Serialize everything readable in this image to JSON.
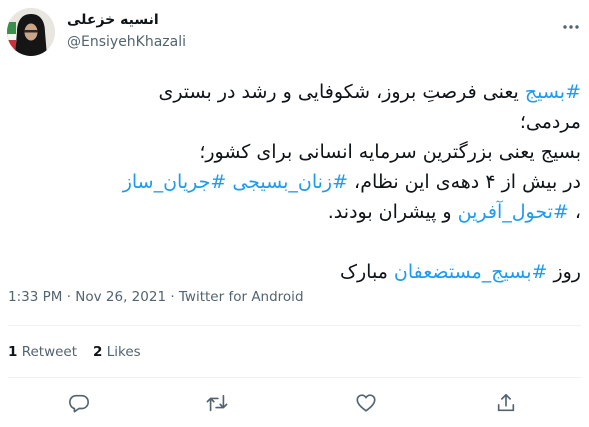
{
  "author": {
    "name": "انسیه خزعلی",
    "handle": "@EnsiyehKhazali"
  },
  "tweet": {
    "lines": [
      [
        {
          "text": "#بسیج",
          "hashtag": true
        },
        {
          "text": " یعنی فرصتِ بروز، شکوفایی و رشد در بستری",
          "hashtag": false
        }
      ],
      [
        {
          "text": "مردمی؛",
          "hashtag": false
        }
      ],
      [
        {
          "text": "بسیج یعنی بزرگترین سرمایه انسانی برای کشور؛",
          "hashtag": false
        }
      ],
      [
        {
          "text": " در بیش از ۴ دهه‌ی این نظام، ",
          "hashtag": false
        },
        {
          "text": "#زنان_بسیجی",
          "hashtag": true
        },
        {
          "text": " ",
          "hashtag": false
        },
        {
          "text": "#جریان_ساز",
          "hashtag": true
        }
      ],
      [
        {
          "text": "، ",
          "hashtag": false
        },
        {
          "text": "#تحول_آفرین",
          "hashtag": true
        },
        {
          "text": " و پیشران بودند.",
          "hashtag": false
        }
      ],
      [],
      [
        {
          "text": "روز ",
          "hashtag": false
        },
        {
          "text": "#بسیج_مستضعفان",
          "hashtag": true
        },
        {
          "text": " مبارک",
          "hashtag": false
        }
      ]
    ]
  },
  "meta": {
    "time": "1:33 PM",
    "separator": " · ",
    "date": "Nov 26, 2021",
    "source": "Twitter for Android"
  },
  "stats": {
    "retweets_count": "1",
    "retweets_label": "Retweet",
    "likes_count": "2",
    "likes_label": "Likes"
  },
  "colors": {
    "link": "#1d9bf0",
    "icon": "#536471",
    "divider": "#eff3f4"
  },
  "icons": [
    "more-icon",
    "reply-icon",
    "retweet-icon",
    "like-icon",
    "share-icon"
  ]
}
